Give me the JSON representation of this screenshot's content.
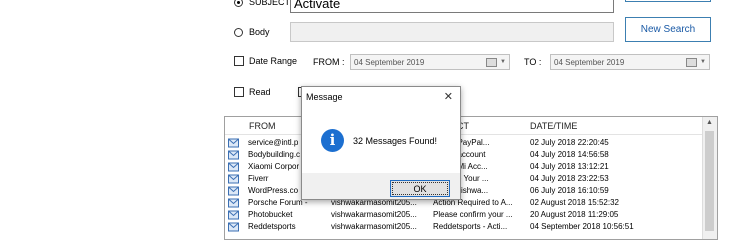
{
  "search": {
    "subject_label": "SUBJECT",
    "subject_value": "Activate",
    "body_label": "Body",
    "body_value": "",
    "new_search_label": "New Search",
    "date_range_label": "Date Range",
    "from_label": "FROM :",
    "from_value": "04 September 2019",
    "to_label": "TO :",
    "to_value": "04 September 2019",
    "read_label": "Read"
  },
  "grid": {
    "headers": {
      "from": "FROM",
      "subject": "ECT",
      "datetime": "DATE/TIME"
    },
    "rows": [
      {
        "from": "service@intl.p",
        "to": "",
        "subject": "e your PayPal...",
        "datetime": "02 July 2018 22:20:45"
      },
      {
        "from": "Bodybuilding.c",
        "to": "",
        "subject": "e your account",
        "datetime": "04 July 2018 14:56:58"
      },
      {
        "from": "Xiaomi Corpor",
        "to": "",
        "subject": "e your Mi Acc...",
        "datetime": "04 July 2018 13:12:21"
      },
      {
        "from": "Fiverr",
        "to": "",
        "subject": "Activate Your ...",
        "datetime": "04 July 2018 23:22:53"
      },
      {
        "from": "WordPress.co",
        "to": "",
        "subject": "e somtvishwa...",
        "datetime": "06 July 2018 16:10:59"
      },
      {
        "from": "Porsche Forum -",
        "to": "vishwakarmasomit205...",
        "subject": "Action Required to A...",
        "datetime": "02 August 2018 15:52:32"
      },
      {
        "from": "Photobucket",
        "to": "vishwakarmasomit205...",
        "subject": "Please confirm your ...",
        "datetime": "20 August 2018 11:29:05"
      },
      {
        "from": "Reddetsports",
        "to": "vishwakarmasomit205...",
        "subject": "Reddetsports - Acti...",
        "datetime": "04 September 2018 10:56:51"
      }
    ]
  },
  "dialog": {
    "title": "Message",
    "message": "32 Messages Found!",
    "ok_label": "OK",
    "close_glyph": "✕",
    "info_glyph": "i"
  },
  "colors": {
    "accent": "#1c6fd0",
    "button_border": "#3c7fb1"
  }
}
